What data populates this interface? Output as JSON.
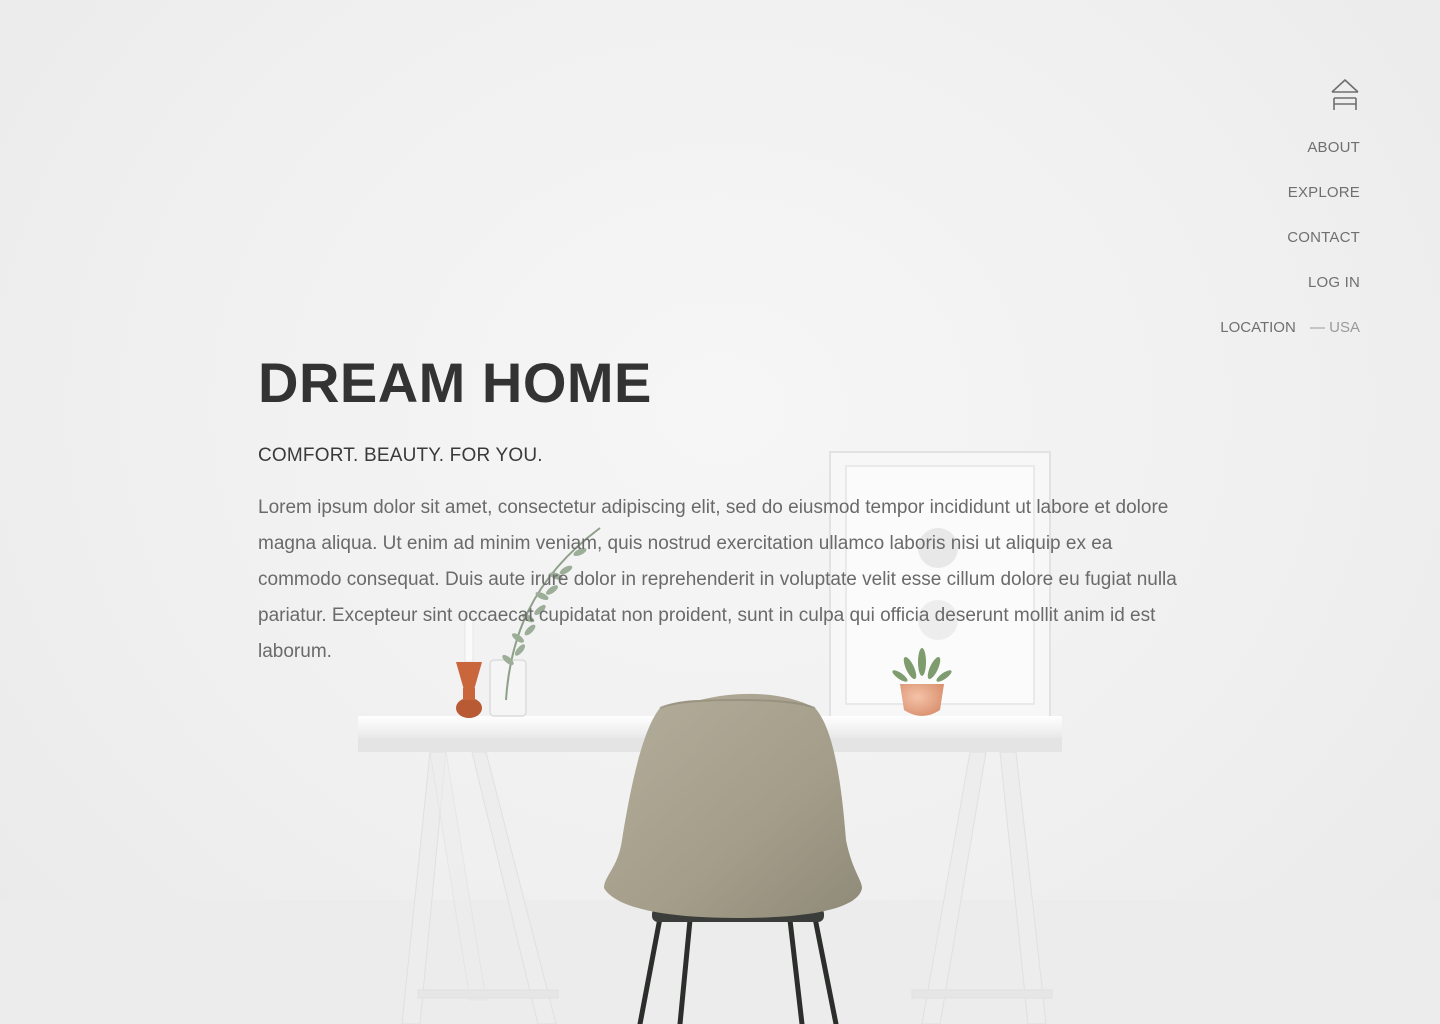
{
  "nav": {
    "logo_icon": "house-outline-icon",
    "items": [
      {
        "label": "ABOUT"
      },
      {
        "label": "EXPLORE"
      },
      {
        "label": "CONTACT"
      },
      {
        "label": "LOG IN"
      }
    ],
    "location": {
      "label": "LOCATION",
      "value": "— USA"
    }
  },
  "hero": {
    "title": "DREAM HOME",
    "subtitle": "COMFORT. BEAUTY. FOR YOU.",
    "body": "Lorem ipsum dolor sit amet, consectetur adipiscing elit, sed do eiusmod tempor incididunt ut labore et dolore magna aliqua. Ut enim ad minim veniam, quis nostrud exercitation ullamco laboris nisi ut aliquip ex ea commodo consequat. Duis aute irure dolor in reprehenderit in voluptate velit esse cillum dolore eu fugiat nulla pariatur. Excepteur sint occaecat cupidatat non proident, sunt in culpa qui officia deserunt mollit anim id est laborum."
  },
  "colors": {
    "background": "#f1f1f1",
    "title": "#333333",
    "nav_text": "#6f6f6f",
    "chair": "#a8a290"
  }
}
